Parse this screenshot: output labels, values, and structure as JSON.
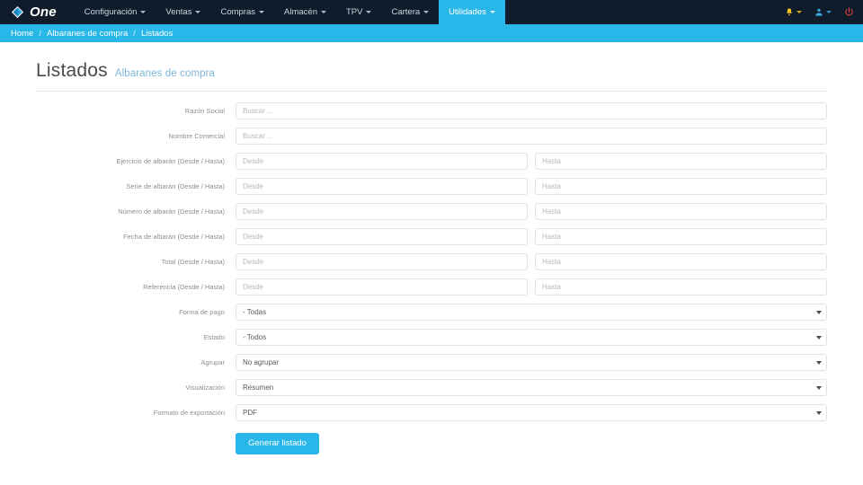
{
  "navbar": {
    "brand": "One",
    "brand_icon": "diamond-logo-icon",
    "items": [
      {
        "label": "Configuración",
        "active": false
      },
      {
        "label": "Ventas",
        "active": false
      },
      {
        "label": "Compras",
        "active": false
      },
      {
        "label": "Almacén",
        "active": false
      },
      {
        "label": "TPV",
        "active": false
      },
      {
        "label": "Cartera",
        "active": false
      },
      {
        "label": "Utilidades",
        "active": true
      }
    ],
    "right_icons": [
      {
        "name": "bell-icon",
        "glyph": "●"
      },
      {
        "name": "user-icon",
        "glyph": "●"
      },
      {
        "name": "power-icon",
        "glyph": "⏻"
      }
    ]
  },
  "breadcrumb": {
    "home": "Home",
    "section": "Albaranes de compra",
    "current": "Listados",
    "separator": "/"
  },
  "header": {
    "title": "Listados",
    "subtitle": "Albaranes de compra"
  },
  "form": {
    "text_rows": [
      {
        "label": "Razón Social",
        "type": "single",
        "placeholder": "Buscar ...",
        "value": ""
      },
      {
        "label": "Nombre Comercial",
        "type": "single",
        "placeholder": "Buscar ...",
        "value": ""
      },
      {
        "label": "Ejercicio de albarán (Desde / Hasta)",
        "type": "range",
        "placeholder_from": "Desde",
        "placeholder_to": "Hasta",
        "value_from": "",
        "value_to": ""
      },
      {
        "label": "Serie de albarán (Desde / Hasta)",
        "type": "range",
        "placeholder_from": "Desde",
        "placeholder_to": "Hasta",
        "value_from": "",
        "value_to": ""
      },
      {
        "label": "Número de albarán (Desde / Hasta)",
        "type": "range",
        "placeholder_from": "Desde",
        "placeholder_to": "Hasta",
        "value_from": "",
        "value_to": ""
      },
      {
        "label": "Fecha de albarán (Desde / Hasta)",
        "type": "range",
        "placeholder_from": "Desde",
        "placeholder_to": "Hasta",
        "value_from": "",
        "value_to": ""
      },
      {
        "label": "Total (Desde / Hasta)",
        "type": "range",
        "placeholder_from": "Desde",
        "placeholder_to": "Hasta",
        "value_from": "",
        "value_to": ""
      },
      {
        "label": "Referencia (Desde / Hasta)",
        "type": "range",
        "placeholder_from": "Desde",
        "placeholder_to": "Hasta",
        "value_from": "",
        "value_to": ""
      }
    ],
    "select_rows": [
      {
        "label": "Forma de pago",
        "value": "- Todas"
      },
      {
        "label": "Estado",
        "value": "- Todos"
      },
      {
        "label": "Agrupar",
        "value": "No agrupar"
      },
      {
        "label": "Visualización",
        "value": "Resumen"
      },
      {
        "label": "Formato de exportación",
        "value": "PDF"
      }
    ],
    "submit_label": "Generar listado"
  },
  "colors": {
    "navbar_bg": "#101c2b",
    "accent": "#29b6e8",
    "title": "#4a4a4a",
    "subtitle": "#7db6d8",
    "label": "#8a8f94",
    "border": "#dfe2e5"
  }
}
